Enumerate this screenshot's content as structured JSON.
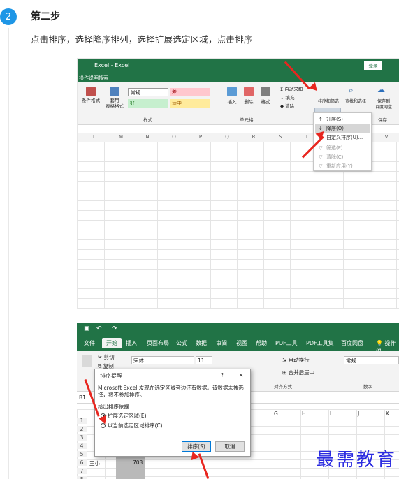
{
  "step": {
    "number": "2",
    "title": "第二步",
    "description": "点击排序，选择降序排列，选择扩展选定区域，点击排序"
  },
  "screenshot1": {
    "title": "Excel - Excel",
    "login_button": "登录",
    "search_label": "操作说明搜索",
    "ribbon": {
      "conditional_format": "条件格式",
      "table_format": "套用\n表格格式",
      "styles": {
        "normal": "常规",
        "bad": "差",
        "good": "好",
        "neutral": "适中"
      },
      "styles_group": "样式",
      "insert": "插入",
      "delete": "删除",
      "format": "格式",
      "cells_group": "单元格",
      "autosum": "自动求和",
      "fill": "填充",
      "clear": "清除",
      "sort_filter": "排序和筛选",
      "find_select": "查找和选择",
      "save_to": "保存到\n百度网盘",
      "save_group": "保存"
    },
    "columns": [
      "L",
      "M",
      "N",
      "O",
      "P",
      "Q",
      "R",
      "S",
      "T",
      "U",
      "V"
    ],
    "dropdown": [
      {
        "label": "升序(S)",
        "icon": "sort-asc-icon"
      },
      {
        "label": "降序(O)",
        "icon": "sort-desc-icon"
      },
      {
        "label": "自定义排序(U)...",
        "icon": "custom-sort-icon"
      },
      {
        "label": "筛选(F)",
        "icon": "filter-icon"
      },
      {
        "label": "清除(C)",
        "icon": "clear-filter-icon"
      },
      {
        "label": "重新应用(Y)",
        "icon": "reapply-icon"
      }
    ]
  },
  "screenshot2": {
    "tabs": [
      "文件",
      "开始",
      "插入",
      "页面布局",
      "公式",
      "数据",
      "审阅",
      "视图",
      "帮助",
      "PDF工具",
      "PDF工具集",
      "百度网盘",
      "操作说"
    ],
    "active_tab": "开始",
    "ribbon": {
      "cut": "剪切",
      "copy": "复制",
      "font_name": "宋体",
      "font_size": "11",
      "wrap": "自动换行",
      "merge": "合并后居中",
      "align_group": "对齐方式",
      "number_format": "常规",
      "number_group": "数字"
    },
    "name_box": "B1",
    "columns": [
      "G",
      "H",
      "I",
      "J",
      "K"
    ],
    "rows": [
      "1",
      "2",
      "3",
      "4",
      "5",
      "6",
      "7",
      "8"
    ],
    "row6_name": "王小",
    "row6_value": "703",
    "dialog": {
      "title": "排序提醒",
      "help": "?",
      "close": "✕",
      "message": "Microsoft Excel 发现在选定区域旁边还有数据。该数据未被选择，将不参加排序。",
      "group": "给出排序依据",
      "option1": "扩展选定区域(E)",
      "option2": "以当前选定区域排序(C)",
      "ok": "排序(S)",
      "cancel": "取消"
    }
  },
  "watermark": "最需教育",
  "colors": {
    "excel_green": "#217346",
    "step_blue": "#1e96e6",
    "arrow_red": "#e8261f",
    "watermark": "#2b2be0"
  }
}
